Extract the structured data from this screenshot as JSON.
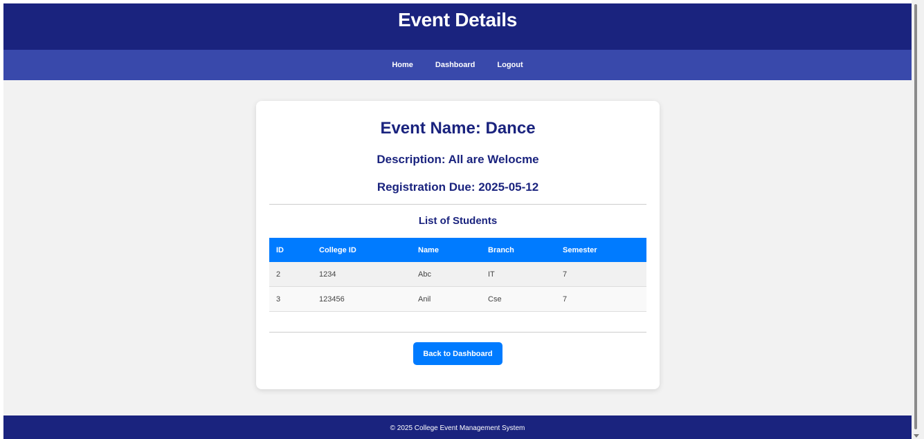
{
  "header": {
    "title": "Event Details"
  },
  "nav": {
    "home": "Home",
    "dashboard": "Dashboard",
    "logout": "Logout"
  },
  "event": {
    "name": "Event Name: Dance",
    "description": "Description: All are Welocme",
    "registration_due": "Registration Due: 2025-05-12"
  },
  "students": {
    "title": "List of Students",
    "columns": [
      "ID",
      "College ID",
      "Name",
      "Branch",
      "Semester"
    ],
    "rows": [
      [
        "2",
        "1234",
        "Abc",
        "IT",
        "7"
      ],
      [
        "3",
        "123456",
        "Anil",
        "Cse",
        "7"
      ]
    ]
  },
  "actions": {
    "back_label": "Back to Dashboard"
  },
  "footer": {
    "text": "© 2025 College Event Management System"
  },
  "colors": {
    "header_bg": "#1a237e",
    "nav_bg": "#3949ab",
    "accent": "#007bff",
    "page_bg": "#f2f2f2"
  }
}
